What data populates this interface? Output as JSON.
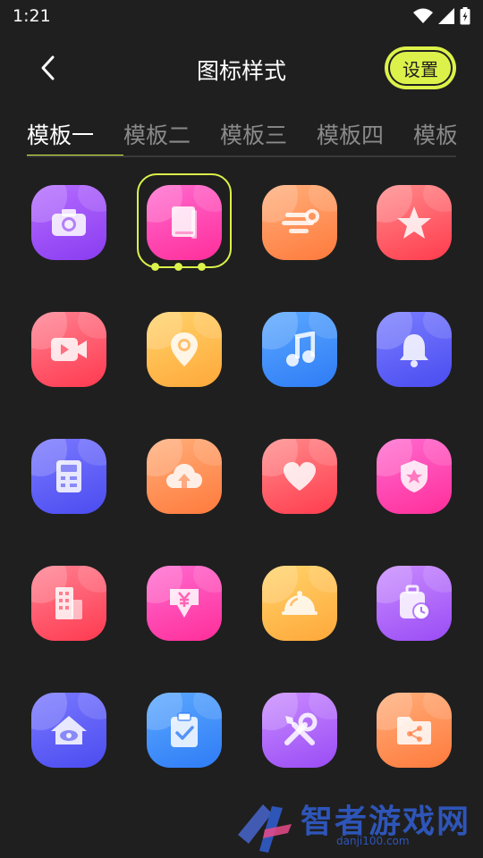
{
  "status": {
    "time": "1:21"
  },
  "header": {
    "title": "图标样式",
    "settings_label": "设置"
  },
  "tabs": [
    {
      "label": "模板一",
      "active": true
    },
    {
      "label": "模板二",
      "active": false
    },
    {
      "label": "模板三",
      "active": false
    },
    {
      "label": "模板四",
      "active": false
    },
    {
      "label": "模板五",
      "active": false
    }
  ],
  "icons": [
    {
      "name": "camera",
      "gradient": [
        "#b56cff",
        "#8a3cf0"
      ]
    },
    {
      "name": "book",
      "gradient": [
        "#ff6ad0",
        "#ff2e9a"
      ],
      "selected": true
    },
    {
      "name": "wind",
      "gradient": [
        "#ffae7a",
        "#ff7a3c"
      ]
    },
    {
      "name": "star",
      "gradient": [
        "#ff8a8a",
        "#ff3c4e"
      ]
    },
    {
      "name": "video",
      "gradient": [
        "#ff8090",
        "#ff3a50"
      ]
    },
    {
      "name": "location",
      "gradient": [
        "#ffd36a",
        "#ffa83a"
      ]
    },
    {
      "name": "music",
      "gradient": [
        "#5aa8ff",
        "#2f7cf6"
      ]
    },
    {
      "name": "bell",
      "gradient": [
        "#7a7dff",
        "#4a4cf0"
      ]
    },
    {
      "name": "calculator",
      "gradient": [
        "#7a78ff",
        "#4b4cf0"
      ]
    },
    {
      "name": "cloud-upload",
      "gradient": [
        "#ffae7a",
        "#ff7a3c"
      ]
    },
    {
      "name": "heart",
      "gradient": [
        "#ff8a8a",
        "#ff3c4e"
      ]
    },
    {
      "name": "shield-star",
      "gradient": [
        "#ff6ad0",
        "#ff2e9a"
      ]
    },
    {
      "name": "building",
      "gradient": [
        "#ff8090",
        "#ff3a50"
      ]
    },
    {
      "name": "yuan-download",
      "gradient": [
        "#ff6ad0",
        "#ff2e9a"
      ]
    },
    {
      "name": "food-cloche",
      "gradient": [
        "#ffd36a",
        "#ffa83a"
      ]
    },
    {
      "name": "luggage-clock",
      "gradient": [
        "#c98bff",
        "#9a4cf5"
      ]
    },
    {
      "name": "home-eye",
      "gradient": [
        "#7a78ff",
        "#4b4cf0"
      ]
    },
    {
      "name": "clipboard-check",
      "gradient": [
        "#5aa8ff",
        "#2f7cf6"
      ]
    },
    {
      "name": "tools",
      "gradient": [
        "#c98bff",
        "#9a4cf5"
      ]
    },
    {
      "name": "folder-share",
      "gradient": [
        "#ffae7a",
        "#ff7a3c"
      ]
    }
  ],
  "watermark": {
    "title": "智者游戏网",
    "subtitle": "danji100.com"
  }
}
